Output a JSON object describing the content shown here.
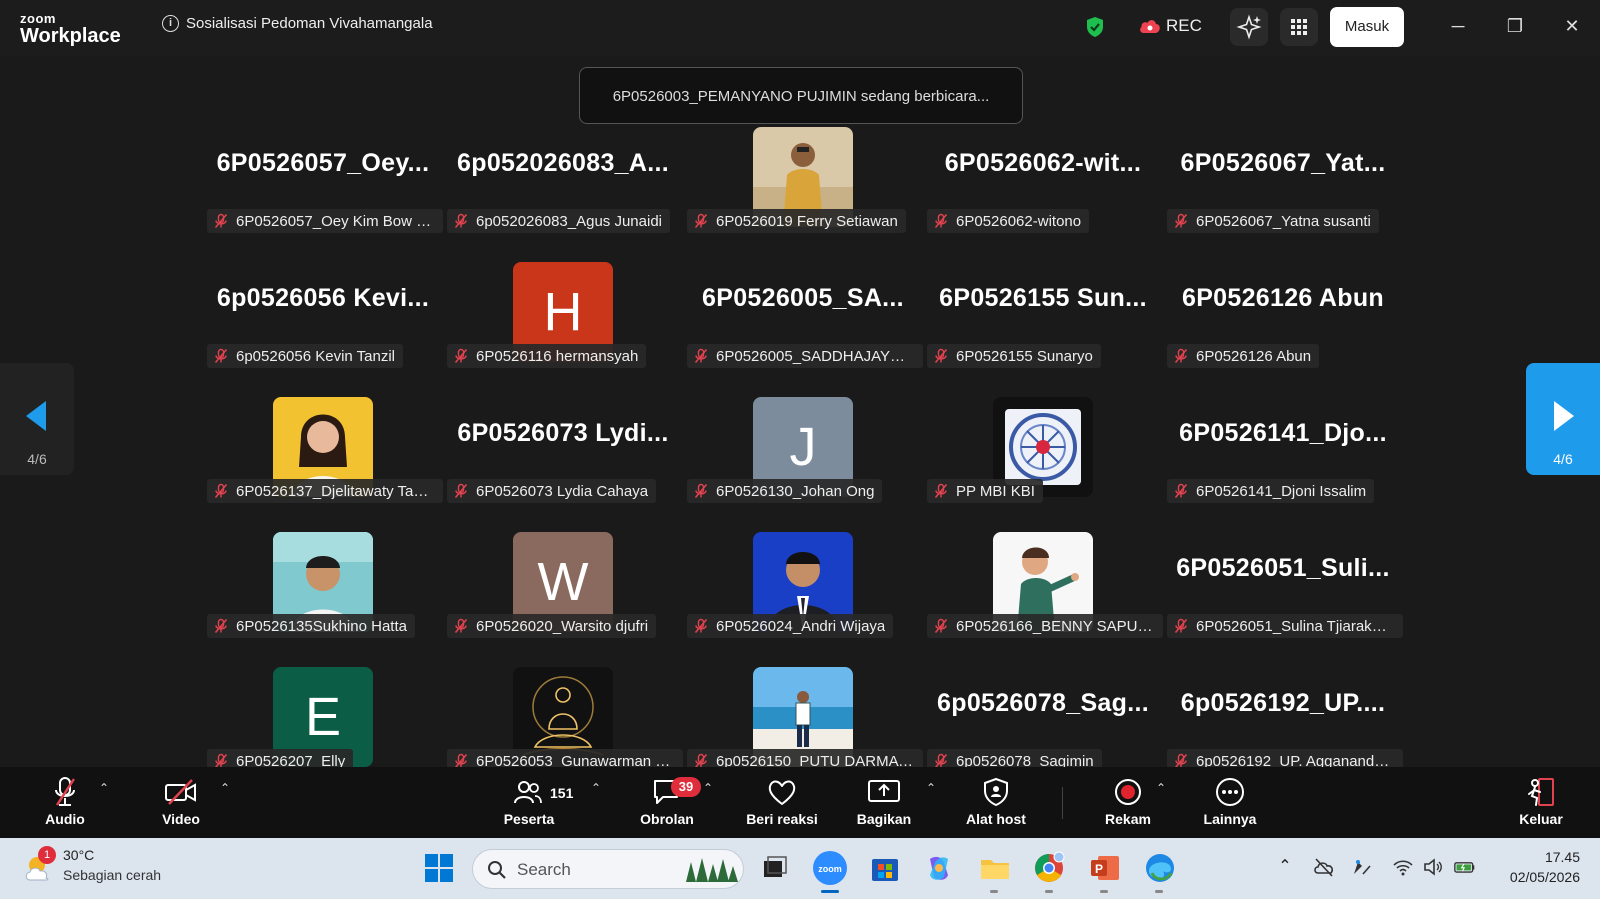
{
  "app": {
    "logo_line1": "zoom",
    "logo_line2": "Workplace",
    "meeting_title": "Sosialisasi Pedoman Vivahamangala",
    "rec_label": "REC",
    "signin_label": "Masuk",
    "minimize": "─",
    "restore": "❐",
    "close": "✕"
  },
  "speaker_toast": "6P0526003_PEMANYANO PUJIMIN sedang berbicara...",
  "pager": {
    "left": "4/6",
    "right": "4/6"
  },
  "tiles": [
    {
      "big": "6P0526057_Oey...",
      "name": "6P0526057_Oey Kim Bow St..."
    },
    {
      "big": "6p052026083_A...",
      "name": "6p052026083_Agus Junaidi"
    },
    {
      "big": "",
      "name": "6P0526019 Ferry Setiawan",
      "avatar": "photo-man-yellow"
    },
    {
      "big": "6P0526062-wit...",
      "name": "6P0526062-witono"
    },
    {
      "big": "6P0526067_Yat...",
      "name": "6P0526067_Yatna susanti"
    },
    {
      "big": "6p0526056  Kevi...",
      "name": "6p0526056 Kevin Tanzil"
    },
    {
      "big": "",
      "name": "6P0526116 hermansyah",
      "letter": "H",
      "color": "#c9361a"
    },
    {
      "big": "6P0526005_SA...",
      "name": "6P0526005_SADDHAJAYO S..."
    },
    {
      "big": "6P0526155  Sun...",
      "name": "6P0526155 Sunaryo"
    },
    {
      "big": "6P0526126 Abun",
      "name": "6P0526126 Abun"
    },
    {
      "big": "",
      "name": "6P0526137_Djelitawaty Taslim",
      "avatar": "photo-woman-yellow"
    },
    {
      "big": "6P0526073  Lydi...",
      "name": "6P0526073 Lydia Cahaya"
    },
    {
      "big": "",
      "name": "6P0526130_Johan Ong",
      "letter": "J",
      "color": "#7d8c9c"
    },
    {
      "big": "",
      "name": "PP MBI KBI",
      "avatar": "logo-emblem"
    },
    {
      "big": "6P0526141_Djo...",
      "name": "6P0526141_Djoni Issalim"
    },
    {
      "big": "",
      "name": "6P0526135Sukhino Hatta",
      "avatar": "photo-man-teal"
    },
    {
      "big": "",
      "name": "6P0526020_Warsito djufri",
      "letter": "W",
      "color": "#8a6a5e"
    },
    {
      "big": "",
      "name": "6P0526024_Andri Wijaya",
      "avatar": "photo-man-blue"
    },
    {
      "big": "",
      "name": "6P0526166_BENNY SAPUTRA",
      "avatar": "cartoon-man"
    },
    {
      "big": "6P0526051_Suli...",
      "name": "6P0526051_Sulina Tjiarakus..."
    },
    {
      "big": "",
      "name": "6P0526207_Elly",
      "letter": "E",
      "color": "#0b5d45"
    },
    {
      "big": "",
      "name": "6P0526053_Gunawarman Fr...",
      "avatar": "buddha-gold"
    },
    {
      "big": "",
      "name": "6p0526150_PUTU DARMAW...",
      "avatar": "photo-beach"
    },
    {
      "big": "6p0526078_Sag...",
      "name": "6p0526078_Sagimin"
    },
    {
      "big": "6p0526192_UP....",
      "name": "6p0526192_UP. Agganando ..."
    }
  ],
  "toolbar": {
    "audio": "Audio",
    "video": "Video",
    "participants": "Peserta",
    "participants_count": "151",
    "chat": "Obrolan",
    "chat_badge": "39",
    "react": "Beri reaksi",
    "share": "Bagikan",
    "host_tools": "Alat host",
    "record": "Rekam",
    "more": "Lainnya",
    "leave": "Keluar"
  },
  "taskbar": {
    "weather_temp": "30°C",
    "weather_desc": "Sebagian cerah",
    "weather_badge": "1",
    "search_placeholder": "Search",
    "time": "17.45",
    "date": "02/05/2026"
  },
  "colors": {
    "accent": "#1e9bea",
    "muted_mic": "#e0424e",
    "record": "#e0242f"
  }
}
